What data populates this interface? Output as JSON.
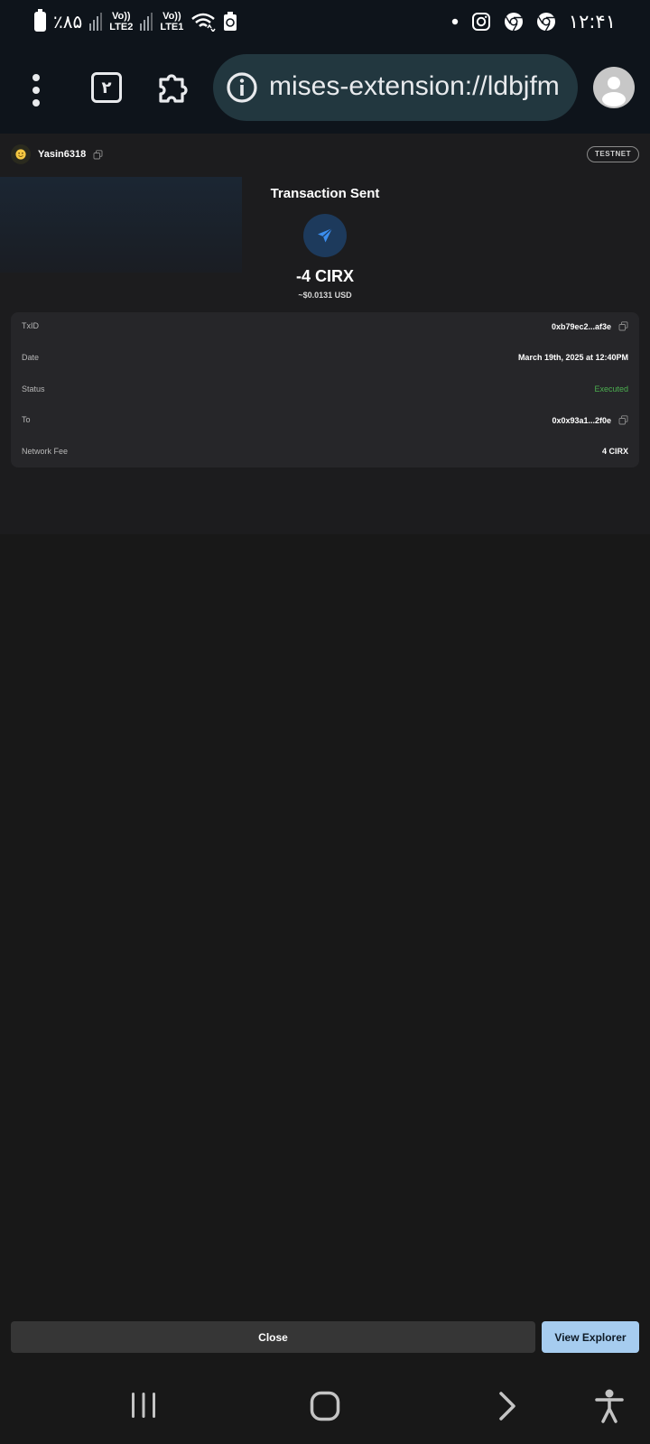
{
  "status_bar": {
    "battery_text": "٪۸۵",
    "sim2_label": "LTE2",
    "sim1_label": "LTE1",
    "volte_label": "Vo))",
    "time": "۱۲:۴۱"
  },
  "browser": {
    "tab_count": "۲",
    "url": "mises-extension://ldbjfm"
  },
  "wallet": {
    "account_name": "Yasin6318",
    "network_badge": "TESTNET",
    "title": "Transaction Sent",
    "amount": "-4 CIRX",
    "usd_value": "~$0.0131 USD",
    "details": [
      {
        "label": "TxID",
        "value": "0xb79ec2...af3e"
      },
      {
        "label": "Date",
        "value": "March 19th, 2025 at 12:40PM"
      },
      {
        "label": "Status",
        "value": "Executed"
      },
      {
        "label": "To",
        "value": "0x0x93a1...2f0e"
      },
      {
        "label": "Network Fee",
        "value": "4 CIRX"
      }
    ]
  },
  "actions": {
    "close_label": "Close",
    "explorer_label": "View Explorer"
  },
  "colors": {
    "status_ok": "#4caf50",
    "primary_button": "#a6ccef",
    "send_icon": "#3b8ef0"
  }
}
